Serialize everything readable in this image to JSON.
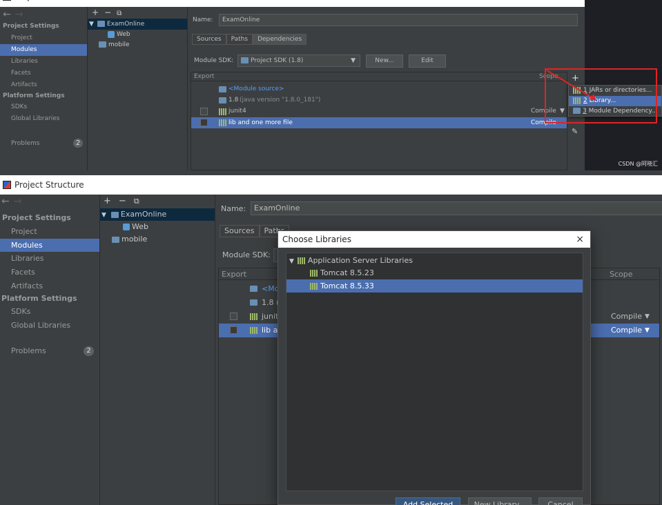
{
  "window_title": "Project Structure",
  "close_glyph": "×",
  "nav": {
    "back": "←",
    "forward": "→",
    "project_settings": "Project Settings",
    "project_items": [
      "Project",
      "Modules",
      "Libraries",
      "Facets",
      "Artifacts"
    ],
    "platform_settings": "Platform Settings",
    "platform_items": [
      "SDKs",
      "Global Libraries"
    ],
    "problems_label": "Problems",
    "problems_count": "2"
  },
  "tree": {
    "add": "+",
    "remove": "−",
    "copy": "⧉",
    "expand": "▼",
    "root": "ExamOnline",
    "child": "Web",
    "other": "mobile"
  },
  "module": {
    "name_label": "Name:",
    "name_value": "ExamOnline",
    "tabs": [
      "Sources",
      "Paths",
      "Dependencies"
    ],
    "sdk_label": "Module SDK:",
    "sdk_value": "Project SDK (1.8)",
    "new_button": "New...",
    "edit_button": "Edit",
    "col_export": "Export",
    "col_scope": "Scope",
    "rows": [
      {
        "name": "<Module source>",
        "scope": ""
      },
      {
        "name": "1.8",
        "extra": "(java version \"1.8.0_181\")",
        "scope": ""
      },
      {
        "name": "junit4",
        "scope": "Compile"
      },
      {
        "name": "lib and one more file",
        "scope": "Compile"
      }
    ],
    "rows_truncated": [
      "<Mo",
      "1.8 (",
      "junit",
      "lib ar"
    ]
  },
  "side_tools": {
    "add": "+",
    "edit": "✎"
  },
  "add_popup": {
    "items": [
      {
        "num": "1",
        "label": "JARs or directories..."
      },
      {
        "num": "2",
        "label": "Library..."
      },
      {
        "num": "3",
        "label": "Module Dependency..."
      }
    ]
  },
  "watermark": "CSDN @阿晓汇",
  "dialog": {
    "title": "Choose Libraries",
    "group": "Application Server Libraries",
    "items": [
      "Tomcat 8.5.23",
      "Tomcat 8.5.33"
    ],
    "buttons": [
      "Add Selected",
      "New Library...",
      "Cancel"
    ]
  },
  "colors": {
    "selection": "#4b6eaf",
    "link": "#589df6",
    "highlight_box": "#e02424",
    "background": "#3c3f41"
  }
}
